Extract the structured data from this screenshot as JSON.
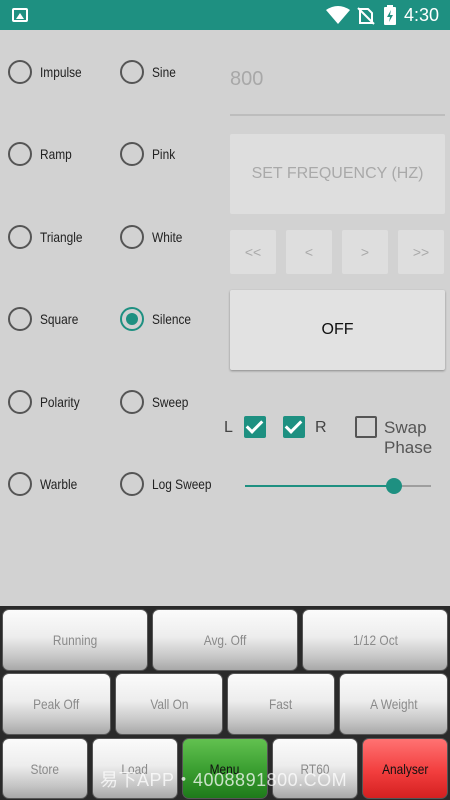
{
  "status_bar": {
    "time": "4:30"
  },
  "waveforms": {
    "col1": [
      {
        "label": "Impulse",
        "checked": false
      },
      {
        "label": "Ramp",
        "checked": false
      },
      {
        "label": "Triangle",
        "checked": false
      },
      {
        "label": "Square",
        "checked": false
      },
      {
        "label": "Polarity",
        "checked": false
      },
      {
        "label": "Warble",
        "checked": false
      }
    ],
    "col2": [
      {
        "label": "Sine",
        "checked": false
      },
      {
        "label": "Pink",
        "checked": false
      },
      {
        "label": "White",
        "checked": false
      },
      {
        "label": "Silence",
        "checked": true
      },
      {
        "label": "Sweep",
        "checked": false
      },
      {
        "label": "Log Sweep",
        "checked": false
      }
    ]
  },
  "frequency": {
    "value": "800",
    "set_label": "SET FREQUENCY (HZ)"
  },
  "steps": [
    "<<",
    "<",
    ">",
    ">>"
  ],
  "toggle": {
    "label": "OFF"
  },
  "channels": {
    "left_label": "L",
    "left_checked": true,
    "right_label": "R",
    "right_checked": true,
    "swap_label_1": "Swap",
    "swap_label_2": "Phase",
    "swap_checked": false
  },
  "level": {
    "fraction": 0.8
  },
  "colors": {
    "accent": "#1e9081",
    "menu_button": "#3ca032",
    "analyser_button": "#f23e3e"
  },
  "bottom_buttons": {
    "row1": [
      "Running",
      "Avg. Off",
      "1/12 Oct"
    ],
    "row2": [
      "Peak Off",
      "Vall On",
      "Fast",
      "A Weight"
    ],
    "row3": [
      "Store",
      "Load",
      "Menu",
      "RT60",
      "Analyser"
    ]
  },
  "watermark": "易下APP・4008891800.COM"
}
